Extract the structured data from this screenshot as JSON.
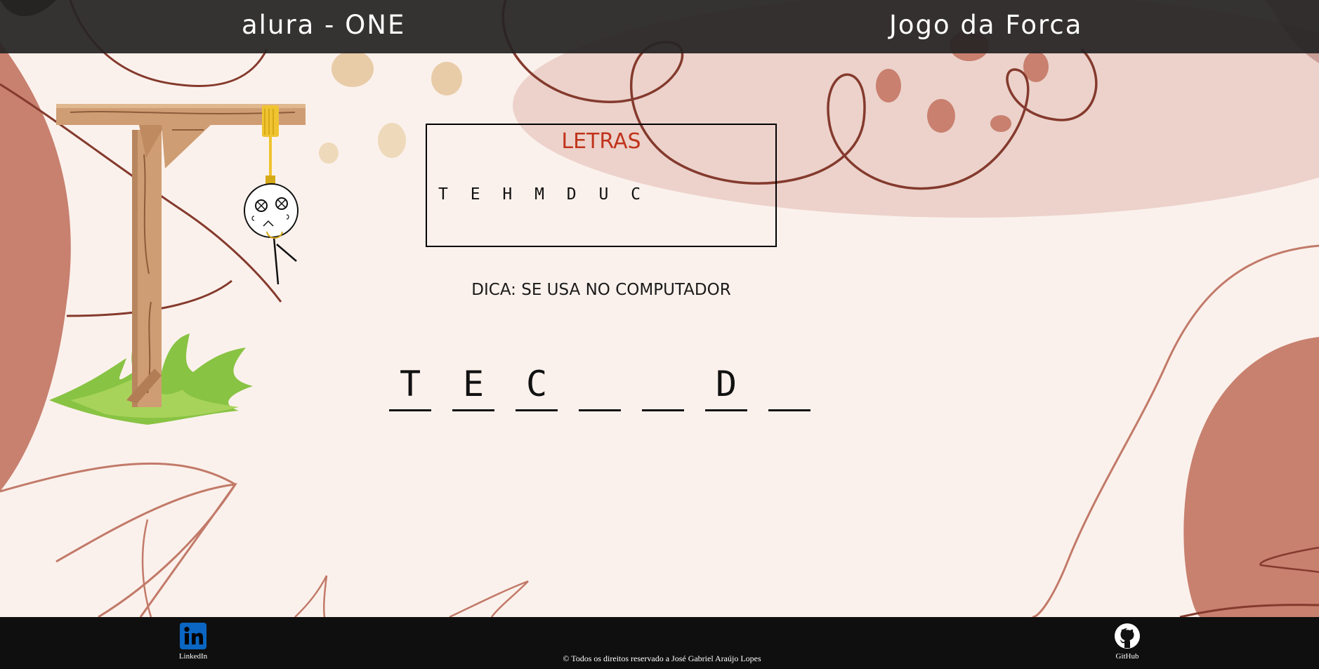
{
  "header": {
    "brand": "alura - ONE",
    "title": "Jogo da Forca"
  },
  "letters_panel": {
    "title": "LETRAS",
    "used": "T E H M D U C"
  },
  "hint": "DICA: SE USA NO COMPUTADOR",
  "word_slots": [
    "T",
    "E",
    "C",
    "",
    "",
    "D",
    ""
  ],
  "footer": {
    "linkedin_label": "LinkedIn",
    "github_label": "GitHub",
    "copyright": "© Todos os direitos reservado a José Gabriel Araújo Lopes"
  },
  "colors": {
    "header_bg": "#262423",
    "footer_bg": "#0f0f0f",
    "letters_title": "#c0331b",
    "background": "#fbf1ec",
    "accent_terracotta": "#c98070",
    "linkedin_blue": "#0a66c2"
  },
  "icons": [
    "linkedin-icon",
    "github-icon"
  ]
}
